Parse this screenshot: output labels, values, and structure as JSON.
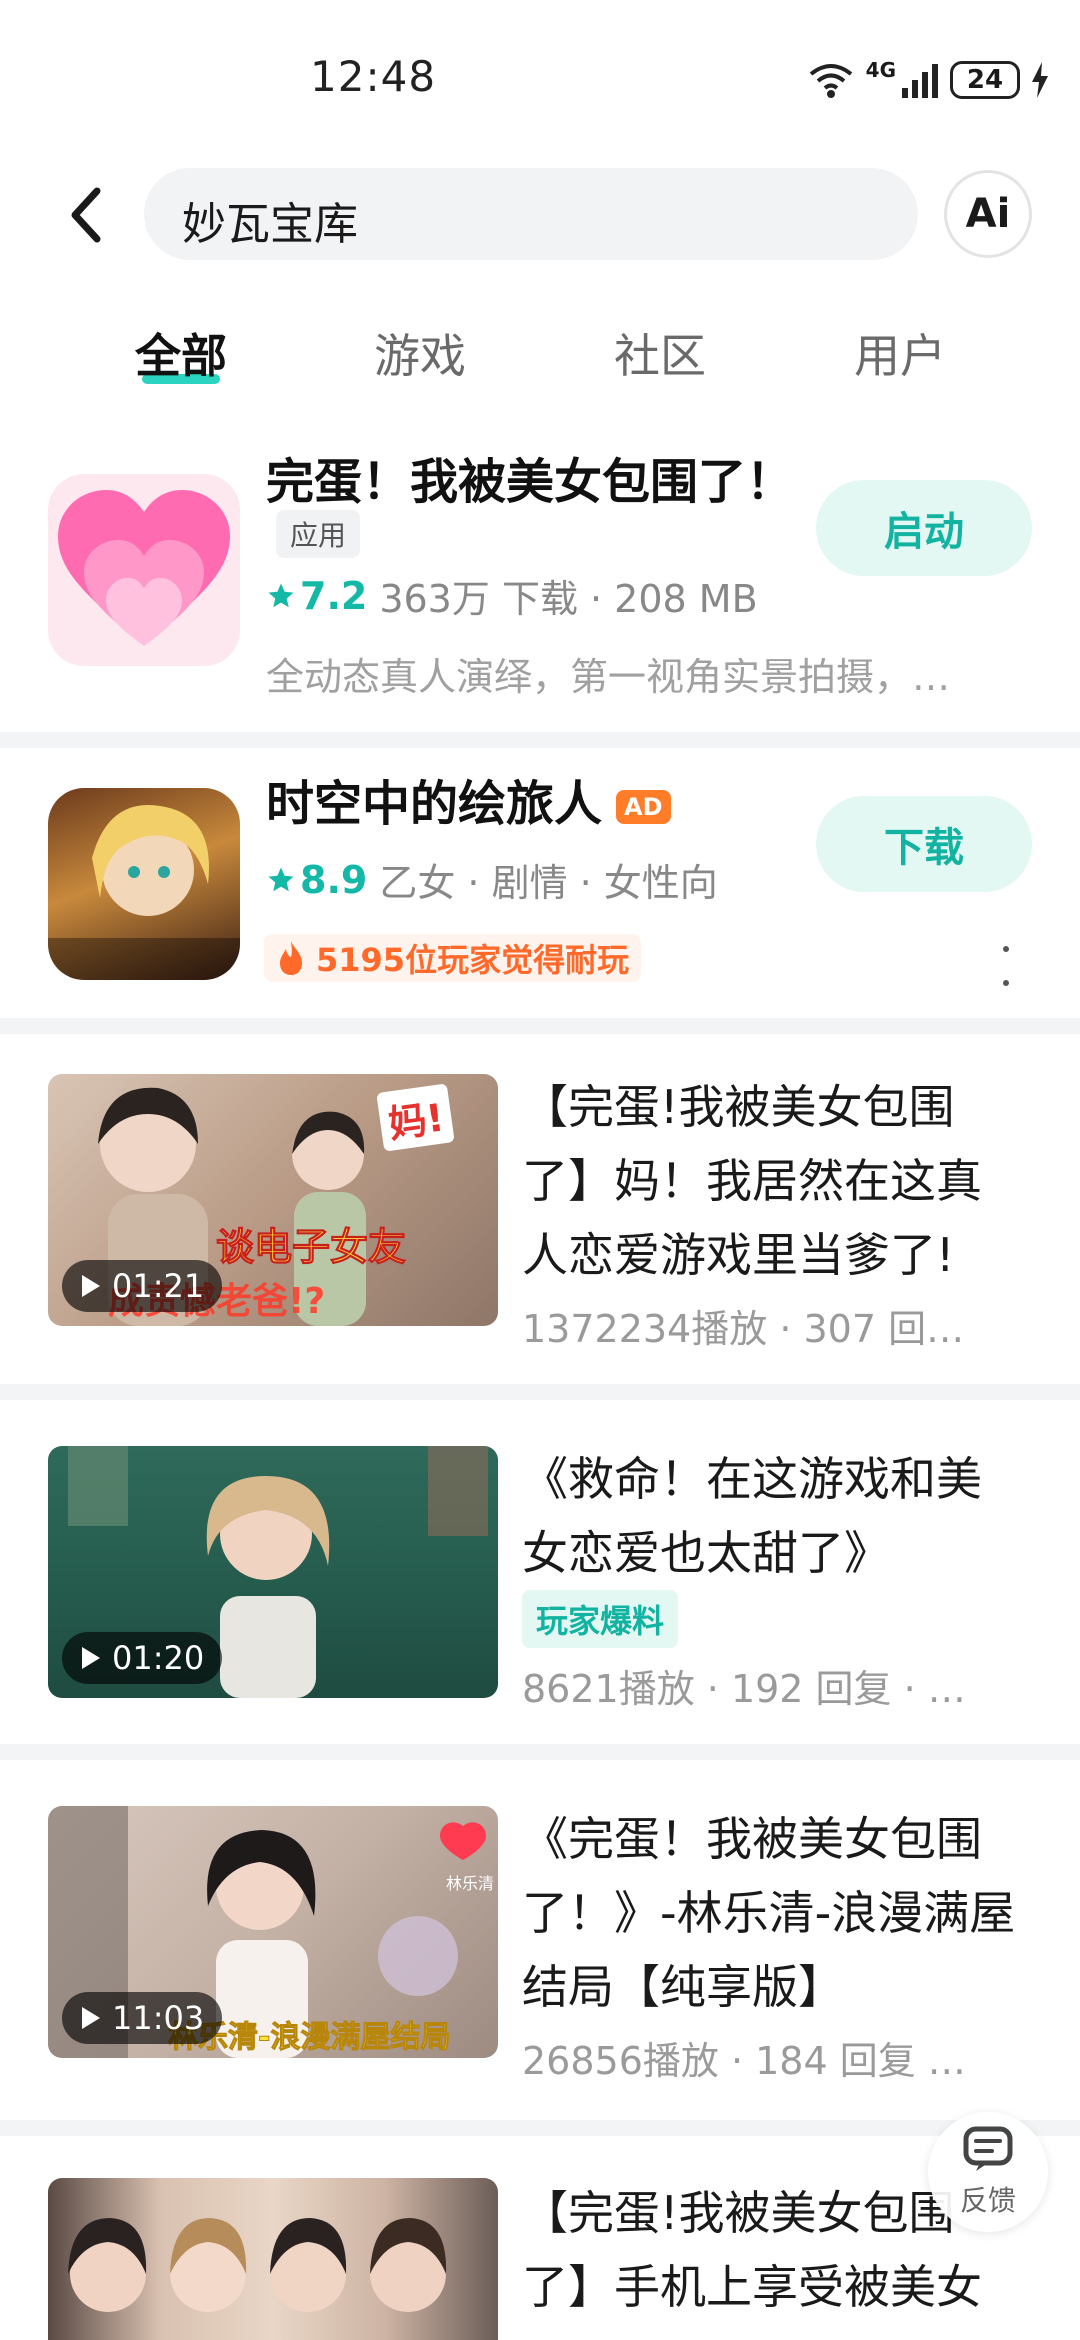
{
  "status_bar": {
    "time": "12:48",
    "battery": "24",
    "network": "4G"
  },
  "header": {
    "search_value": "妙瓦宝库",
    "ai_label": "Ai"
  },
  "tabs": [
    {
      "label": "全部",
      "active": true
    },
    {
      "label": "游戏",
      "active": false
    },
    {
      "label": "社区",
      "active": false
    },
    {
      "label": "用户",
      "active": false
    }
  ],
  "app_results": [
    {
      "title": "完蛋！我被美女包围了！",
      "tag": "应用",
      "rating": "7.2",
      "meta": "363万 下载 · 208 MB",
      "description": "全动态真人演绎，第一视角实景拍摄，…",
      "button": "启动",
      "icon": "heart-icon"
    },
    {
      "title": "时空中的绘旅人",
      "ad_badge": "AD",
      "rating": "8.9",
      "meta": "乙女 · 剧情 · 女性向",
      "hot_text": "5195位玩家觉得耐玩",
      "button": "下载",
      "icon": "game-art-icon"
    }
  ],
  "videos": [
    {
      "title": "【完蛋!我被美女包围了】妈！我居然在这真人恋爱游戏里当爹了!",
      "duration": "01:21",
      "meta": "1372234播放 · 307 回…",
      "thumb_caption_top": "妈!",
      "thumb_caption_mid": "谈电子女友",
      "thumb_caption_bottom": "成责憾老爸!?"
    },
    {
      "title": "《救命！在这游戏和美女恋爱也太甜了》",
      "duration": "01:20",
      "tag": "玩家爆料",
      "meta": "8621播放 · 192 回复 · …"
    },
    {
      "title": "《完蛋！我被美女包围了！》-林乐清-浪漫满屋结局【纯享版】",
      "duration": "11:03",
      "meta": "26856播放 · 184 回复 …",
      "thumb_caption_bottom": "林乐清-浪漫满屋结局",
      "thumb_caption_tag": "林乐清"
    },
    {
      "title": "【完蛋!我被美女包围了】手机上享受被美女"
    }
  ],
  "feedback": {
    "label": "反馈"
  },
  "colors": {
    "accent": "#12b3a0",
    "accent_bg": "#e3f7f3",
    "hot": "#ff6a2a"
  }
}
